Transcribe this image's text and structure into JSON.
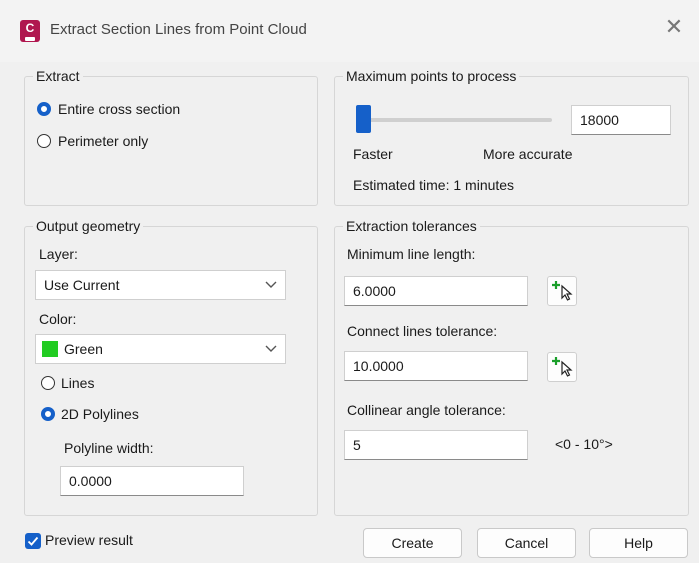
{
  "window": {
    "title": "Extract Section Lines from Point Cloud",
    "app_icon_letter": "C"
  },
  "extract": {
    "label": "Extract",
    "options": [
      {
        "label": "Entire cross section",
        "selected": true
      },
      {
        "label": "Perimeter only",
        "selected": false
      }
    ]
  },
  "max_points": {
    "label": "Maximum points to process",
    "value": "18000",
    "slider_fraction": 0.0,
    "left_label": "Faster",
    "right_label": "More accurate",
    "estimate": "Estimated time: 1 minutes"
  },
  "output": {
    "label": "Output geometry",
    "layer_label": "Layer:",
    "layer_value": "Use Current",
    "color_label": "Color:",
    "color_value": "Green",
    "color_hex": "#22cc22",
    "geometry_options": [
      {
        "label": "Lines",
        "selected": false
      },
      {
        "label": "2D Polylines",
        "selected": true
      }
    ],
    "polyline_width_label": "Polyline width:",
    "polyline_width_value": "0.0000"
  },
  "tolerances": {
    "label": "Extraction tolerances",
    "min_length_label": "Minimum line length:",
    "min_length_value": "6.0000",
    "connect_label": "Connect lines tolerance:",
    "connect_value": "10.0000",
    "collinear_label": "Collinear angle tolerance:",
    "collinear_value": "5",
    "collinear_range": "<0 - 10°>"
  },
  "footer": {
    "preview_label": "Preview result",
    "preview_checked": true,
    "create_label": "Create",
    "cancel_label": "Cancel",
    "help_label": "Help"
  },
  "colors": {
    "accent": "#1560c9",
    "app_icon": "#b0174f"
  }
}
